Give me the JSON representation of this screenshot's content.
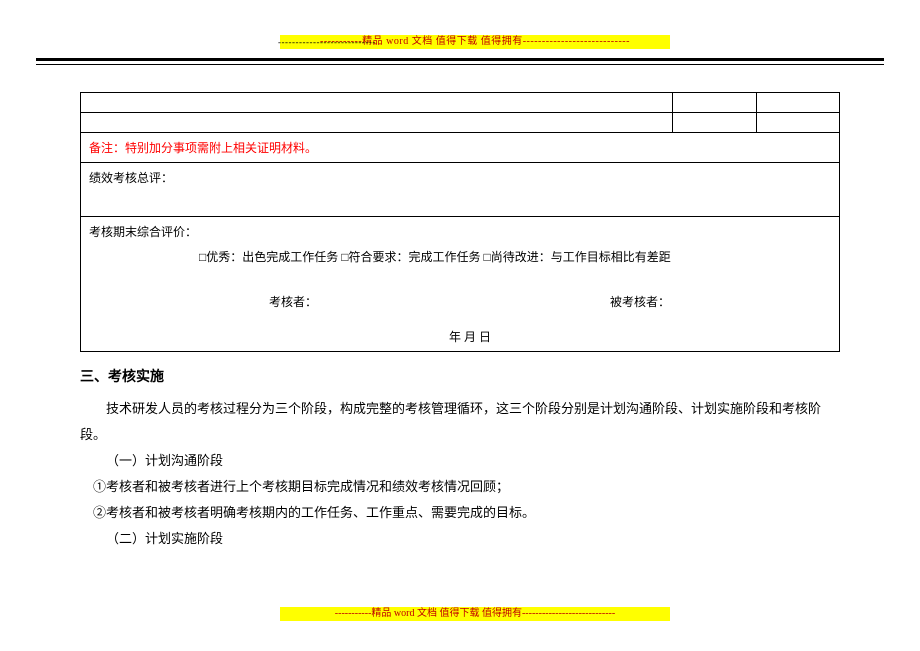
{
  "banner": {
    "top": "-----------精品 word 文档  值得下载  值得拥有----------------------------",
    "bottom": "-----------精品 word 文档  值得下载  值得拥有----------------------------"
  },
  "form": {
    "note": "备注：特别加分事项需附上相关证明材料。",
    "summary_label": "绩效考核总评：",
    "eval_title": "考核期末综合评价：",
    "options": "□优秀：出色完成工作任务     □符合要求：完成工作任务    □尚待改进：与工作目标相比有差距",
    "reviewer_label": "考核者：",
    "reviewee_label": "被考核者：",
    "date_line": "年           月           日"
  },
  "section3": {
    "title": "三、考核实施",
    "intro": "技术研发人员的考核过程分为三个阶段，构成完整的考核管理循环，这三个阶段分别是计划沟通阶段、计划实施阶段和考核阶段。",
    "sub1": "（一）计划沟通阶段",
    "item1": "①考核者和被考核者进行上个考核期目标完成情况和绩效考核情况回顾；",
    "item2": "②考核者和被考核者明确考核期内的工作任务、工作重点、需要完成的目标。",
    "sub2": "（二）计划实施阶段"
  }
}
